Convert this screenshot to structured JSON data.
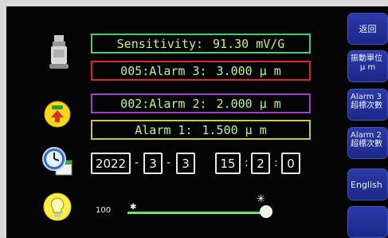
{
  "rows": {
    "sensitivity": {
      "label": "Sensitivity:",
      "value": "91.30 mV/G"
    },
    "alarm3": {
      "label": "005:Alarm 3:",
      "value": "3.000 μ m"
    },
    "alarm2": {
      "label": "002:Alarm 2:",
      "value": "2.000 μ m"
    },
    "alarm1": {
      "label": "Alarm 1:",
      "value": "1.500 μ m"
    }
  },
  "datetime": {
    "year": "2022",
    "month": "3",
    "day": "3",
    "hour": "15",
    "minute": "2",
    "second": "0",
    "date_sep": "-",
    "time_sep": ":"
  },
  "brightness": {
    "value": "100",
    "level": 1.0
  },
  "buttons": {
    "back": "返回",
    "unit_line1": "振動單位",
    "unit_line2": "μ m",
    "alarm3_line1": "Alarm 3",
    "alarm3_line2": "超標次數",
    "alarm2_line1": "Alarm 2",
    "alarm2_line2": "超標次數",
    "english": "English"
  },
  "icons": {
    "sensor": "vibration-sensor-icon",
    "alarm": "alarm-light-icon",
    "clock": "clock-calendar-icon",
    "bulb": "light-bulb-icon"
  },
  "colors": {
    "text_green": "#b9f77a",
    "border_sensitivity": "#3fd06a",
    "border_alarm3": "#d7282a",
    "border_alarm2": "#9c42c8",
    "border_alarm1": "#c8c83a",
    "button_blue": "#2a3aa8"
  }
}
